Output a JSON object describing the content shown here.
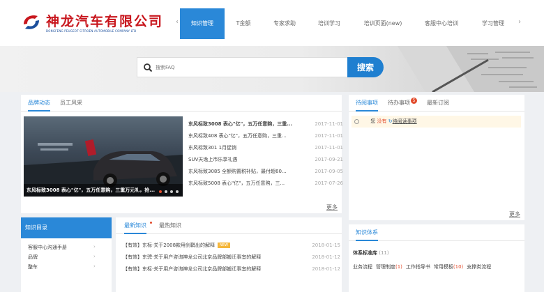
{
  "brand": {
    "name": "神龙汽车有限公司",
    "sub": "DONGFENG PEUGEOT CITROEN AUTOMOBILE COMPANY LTD",
    "red": "#c8161d",
    "blue": "#1c4f9c"
  },
  "nav": {
    "prev_icon": "chevron-left-icon",
    "next_icon": "chevron-right-icon",
    "items": [
      "知识管理",
      "T金额",
      "专家求助",
      "培训学习",
      "培训页面(new)",
      "客服中心培训",
      "学习管理"
    ],
    "active_index": 0,
    "accent": "#2a88d8"
  },
  "search": {
    "placeholder": "搜索FAQ",
    "button": "搜索"
  },
  "news": {
    "tabs": [
      "品牌动态",
      "员工风采"
    ],
    "active_tab": 0,
    "caption": "东风标致3008 表心\"亿\"，五万任意购，三重万元礼，抢...",
    "slides": 4,
    "active_slide": 0,
    "items": [
      {
        "title": "东风标致3008 表心\"亿\"，五万任意购，三重...",
        "date": "2017-11-01",
        "bold": true
      },
      {
        "title": "东风标致408 表心\"亿\"，五万任意购，三重...",
        "date": "2017-11-01",
        "bold": false
      },
      {
        "title": "东风标致301 1月促销",
        "date": "2017-11-01",
        "bold": false
      },
      {
        "title": "SUV天逸上市乐享礼遇",
        "date": "2017-09-21",
        "bold": false
      },
      {
        "title": "东风标致3085 全额购置税补贴，最付超60...",
        "date": "2017-09-05",
        "bold": false
      },
      {
        "title": "东风标致5008 表心\"亿\"，五万任意购，三...",
        "date": "2017-07-26",
        "bold": false
      }
    ],
    "more": "更多"
  },
  "todo": {
    "tabs": [
      "待阅事项",
      "待办事项",
      "最新订阅"
    ],
    "active_tab": 0,
    "badge": "5",
    "row_prefix": "您",
    "row_highlight": "没有",
    "row_link": "待阅读事项",
    "more": "更多"
  },
  "tree": {
    "title": "知识目录",
    "items": [
      "客服中心沟通手册",
      "品牌",
      "整车"
    ]
  },
  "knowledge": {
    "tabs": [
      "最新知识",
      "最热知识"
    ],
    "active_tab": 0,
    "new_label": "NEW",
    "items": [
      {
        "title": "【有效】东标·关于2008款用剑鞘出的解释",
        "date": "2018-01-15",
        "is_new": true
      },
      {
        "title": "【有效】东骋·关于用户咨询神龙公司北京品牌部搬迁事宜的解释",
        "date": "2018-01-12",
        "is_new": false
      },
      {
        "title": "【有效】东标·关于用户咨询神龙公司北京品牌部搬迁事宜的解释",
        "date": "2018-01-12",
        "is_new": false
      }
    ]
  },
  "system": {
    "title": "知识体系",
    "heading": "体系标准库",
    "heading_count": "(11)",
    "links": [
      {
        "label": "业务流程",
        "count": ""
      },
      {
        "label": "管理制度",
        "count": "(1)"
      },
      {
        "label": "工作指导书",
        "count": ""
      },
      {
        "label": "常用模板",
        "count": "(10)"
      },
      {
        "label": "支撑类流程",
        "count": ""
      }
    ]
  }
}
